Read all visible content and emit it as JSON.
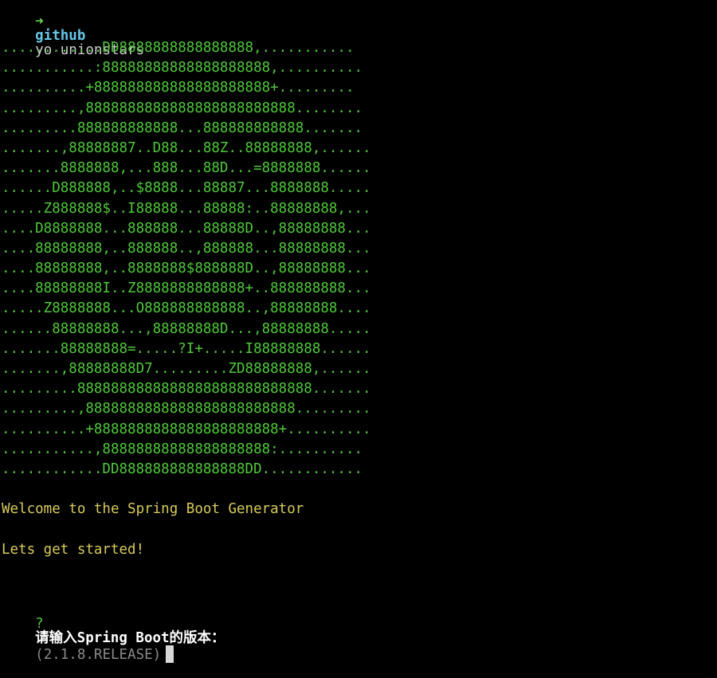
{
  "prompt": {
    "arrow": "➜",
    "directory": "github",
    "command": "yo unionstars"
  },
  "ascii_art": [
    "............DD8888888888888888,...........",
    "...........:88888888888888888888,..........",
    "..........+888888888888888888888+.........",
    ".........,8888888888888888888888888........",
    ".........888888888888...888888888888.......",
    ".......,88888887..D88...88Z..88888888,......",
    ".......8888888,...888...88D...=8888888......",
    "......D888888,..$8888...88887...8888888.....",
    ".....Z888888$..I88888...88888:..88888888,...",
    "....D8888888...888888...88888D..,88888888...",
    "....88888888,..888888..,888888...88888888...",
    "....88888888,..8888888$888888D..,88888888...",
    "....88888888I..Z8888888888888+..888888888...",
    ".....Z8888888...O888888888888..,88888888....",
    "......88888888...,88888888D...,88888888.....",
    ".......88888888=.....?I+.....I88888888......",
    ".......,88888888D7.........ZD88888888,......",
    ".........8888888888888888888888888888.......",
    ".........,8888888888888888888888888.........",
    "..........+8888888888888888888888+..........",
    "...........,88888888888888888888:..........",
    "............DD888888888888888DD............"
  ],
  "messages": {
    "welcome": "Welcome to the Spring Boot Generator",
    "started": "Lets get started!"
  },
  "question": {
    "mark": "?",
    "text": "请输入Spring Boot的版本：",
    "default_value": "(2.1.8.RELEASE)"
  },
  "colors": {
    "art_green": "#4fc93a",
    "prompt_arrow": "#66d94a",
    "prompt_dir": "#66c5e8",
    "message_yellow": "#d8cb5a",
    "background": "#000000"
  }
}
